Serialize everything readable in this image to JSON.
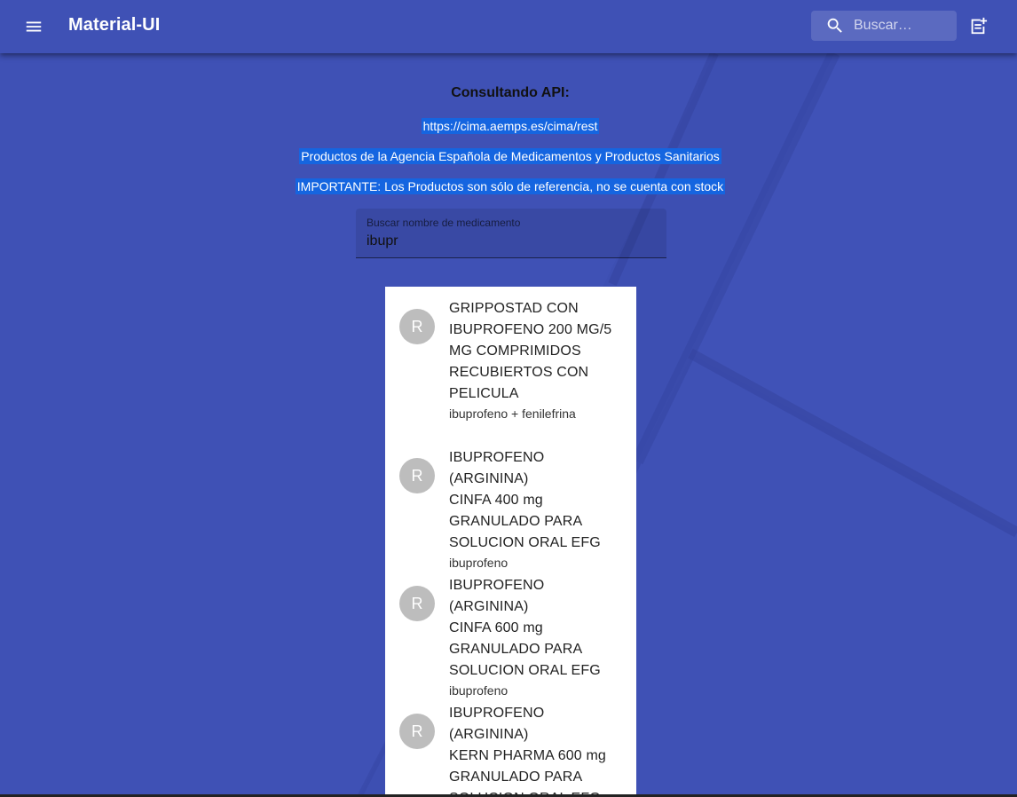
{
  "appbar": {
    "title": "Material-UI",
    "search_placeholder": "Buscar…",
    "menu_icon": "menu-icon",
    "note_add_icon": "note-add-icon",
    "search_icon": "search-icon"
  },
  "main": {
    "heading": "Consultando API:",
    "api_url": "https://cima.aemps.es/cima/rest",
    "description": "Productos de la Agencia Española de Medicamentos y Productos Sanitarios",
    "notice": "IMPORTANTE: Los Productos son sólo de referencia, no se cuenta con stock"
  },
  "search_field": {
    "label": "Buscar nombre de medicamento",
    "value": "ibupr"
  },
  "results": [
    {
      "avatar": "R",
      "lines": [
        "GRIPPOSTAD CON",
        "IBUPROFENO 200 MG/5",
        "MG COMPRIMIDOS",
        "RECUBIERTOS CON",
        "PELICULA"
      ],
      "secondary": "ibuprofeno + fenilefrina"
    },
    {
      "avatar": "R",
      "lines": [
        "IBUPROFENO (ARGININA)",
        "CINFA 400 mg",
        "GRANULADO PARA",
        "SOLUCION ORAL EFG"
      ],
      "secondary": "ibuprofeno"
    },
    {
      "avatar": "R",
      "lines": [
        "IBUPROFENO (ARGININA)",
        "CINFA 600 mg",
        "GRANULADO PARA",
        "SOLUCION ORAL EFG"
      ],
      "secondary": "ibuprofeno"
    },
    {
      "avatar": "R",
      "lines": [
        "IBUPROFENO (ARGININA)",
        "KERN PHARMA 600 mg",
        "GRANULADO PARA",
        "SOLUCION ORAL EFG"
      ],
      "secondary": ""
    }
  ],
  "colors": {
    "primary": "#3f51b5",
    "highlight": "#1565e0",
    "avatar": "#bdbdbd"
  }
}
